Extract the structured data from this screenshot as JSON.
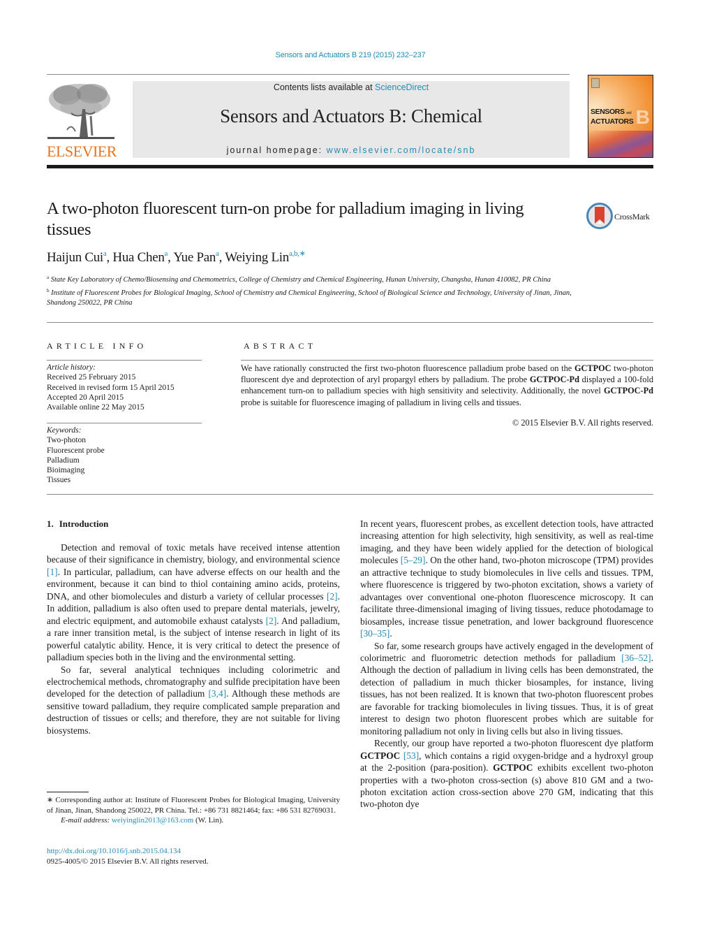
{
  "header": {
    "citation": "Sensors and Actuators B 219 (2015) 232–237",
    "contents_prefix": "Contents lists available at ",
    "contents_link": "ScienceDirect",
    "journal_title": "Sensors and Actuators B: Chemical",
    "homepage_prefix": "journal homepage: ",
    "homepage_link": "www.elsevier.com/locate/snb",
    "publisher_logo": "ELSEVIER",
    "cover": {
      "line1": "SENSORS",
      "and": "and",
      "line2": "ACTUATORS",
      "letter": "B"
    }
  },
  "article": {
    "title": "A two-photon fluorescent turn-on probe for palladium imaging in living tissues",
    "crossmark_label": "CrossMark",
    "authors": [
      {
        "name": "Haijun Cui",
        "aff": "a"
      },
      {
        "name": "Hua Chen",
        "aff": "a"
      },
      {
        "name": "Yue Pan",
        "aff": "a"
      },
      {
        "name": "Weiying Lin",
        "aff": "a,b,∗"
      }
    ],
    "affiliations": [
      {
        "mark": "a",
        "text": "State Key Laboratory of Chemo/Biosensing and Chemometrics, College of Chemistry and Chemical Engineering, Hunan University, Changsha, Hunan 410082, PR China"
      },
      {
        "mark": "b",
        "text": "Institute of Fluorescent Probes for Biological Imaging, School of Chemistry and Chemical Engineering, School of Biological Science and Technology, University of Jinan, Jinan, Shandong 250022, PR China"
      }
    ]
  },
  "article_info": {
    "heading": "ARTICLE INFO",
    "history_label": "Article history:",
    "history": [
      "Received 25 February 2015",
      "Received in revised form 15 April 2015",
      "Accepted 20 April 2015",
      "Available online 22 May 2015"
    ],
    "keywords_label": "Keywords:",
    "keywords": [
      "Two-photon",
      "Fluorescent probe",
      "Palladium",
      "Bioimaging",
      "Tissues"
    ]
  },
  "abstract": {
    "heading": "ABSTRACT",
    "parts": [
      {
        "t": "We have rationally constructed the first two-photon fluorescence palladium probe based on the ",
        "b": false
      },
      {
        "t": "GCTPOC",
        "b": true
      },
      {
        "t": " two-photon fluorescent dye and deprotection of aryl propargyl ethers by palladium. The probe ",
        "b": false
      },
      {
        "t": "GCTPOC-Pd",
        "b": true
      },
      {
        "t": " displayed a 100-fold enhancement turn-on to palladium species with high sensitivity and selectivity. Additionally, the novel ",
        "b": false
      },
      {
        "t": "GCTPOC-Pd",
        "b": true
      },
      {
        "t": " probe is suitable for fluorescence imaging of palladium in living cells and tissues.",
        "b": false
      }
    ],
    "copyright": "© 2015 Elsevier B.V. All rights reserved."
  },
  "introduction": {
    "number": "1.",
    "heading": "Introduction",
    "left_paragraphs": [
      [
        {
          "t": "Detection and removal of toxic metals have received intense attention because of their significance in chemistry, biology, and environmental science "
        },
        {
          "t": "[1]",
          "ref": true
        },
        {
          "t": ". In particular, palladium, can have adverse effects on our health and the environment, because it can bind to thiol containing amino acids, proteins, DNA, and other biomolecules and disturb a variety of cellular processes "
        },
        {
          "t": "[2]",
          "ref": true
        },
        {
          "t": ". In addition, palladium is also often used to prepare dental materials, jewelry, and electric equipment, and automobile exhaust catalysts "
        },
        {
          "t": "[2]",
          "ref": true
        },
        {
          "t": ". And palladium, a rare inner transition metal, is the subject of intense research in light of its powerful catalytic ability. Hence, it is very critical to detect the presence of palladium species both in the living and the environmental setting."
        }
      ],
      [
        {
          "t": "So far, several analytical techniques including colorimetric and electrochemical methods, chromatography and sulfide precipitation have been developed for the detection of palladium "
        },
        {
          "t": "[3,4]",
          "ref": true
        },
        {
          "t": ". Although these methods are sensitive toward palladium, they require complicated sample preparation and destruction of tissues or cells; and therefore, they are not suitable for living biosystems."
        }
      ]
    ],
    "right_paragraphs": [
      [
        {
          "t": "In recent years, fluorescent probes, as excellent detection tools, have attracted increasing attention for high selectivity, high sensitivity, as well as real-time imaging, and they have been widely applied for the detection of biological molecules "
        },
        {
          "t": "[5–29]",
          "ref": true
        },
        {
          "t": ". On the other hand, two-photon microscope (TPM) provides an attractive technique to study biomolecules in live cells and tissues. TPM, where fluorescence is triggered by two-photon excitation, shows a variety of advantages over conventional one-photon fluorescence microscopy. It can facilitate three-dimensional imaging of living tissues, reduce photodamage to biosamples, increase tissue penetration, and lower background fluorescence "
        },
        {
          "t": "[30–35]",
          "ref": true
        },
        {
          "t": "."
        }
      ],
      [
        {
          "t": "So far, some research groups have actively engaged in the development of colorimetric and fluorometric detection methods for palladium "
        },
        {
          "t": "[36–52]",
          "ref": true
        },
        {
          "t": ". Although the dection of palladium in living cells has been demonstrated, the detection of palladium in much thicker biosamples, for instance, living tissues, has not been realized. It is known that two-photon fluorescent probes are favorable for tracking biomolecules in living tissues. Thus, it is of great interest to design two photon fluorescent probes which are suitable for monitoring palladium not only in living cells but also in living tissues."
        }
      ],
      [
        {
          "t": "Recently, our group have reported a two-photon fluorescent dye platform "
        },
        {
          "t": "GCTPOC",
          "bold": true
        },
        {
          "t": " "
        },
        {
          "t": "[53]",
          "ref": true
        },
        {
          "t": ", which contains a rigid oxygen-bridge and a hydroxyl group at the 2-position (para-position). "
        },
        {
          "t": "GCTPOC",
          "bold": true
        },
        {
          "t": " exhibits excellent two-photon properties with a two-photon cross-section (s) above 810 GM and a two-photon excitation action cross-section above 270 GM, indicating that this two-photon dye"
        }
      ]
    ]
  },
  "footnotes": {
    "corresponding": "∗  Corresponding author at: Institute of Fluorescent Probes for Biological Imaging, University of Jinan, Jinan, Shandong 250022, PR China. Tel.: +86 731 8821464; fax: +86 531 82769031.",
    "email_label": "E-mail address:",
    "email": "weiyinglin2013@163.com",
    "email_suffix": " (W. Lin).",
    "doi": "http://dx.doi.org/10.1016/j.snb.2015.04.134",
    "issn_copyright": "0925-4005/© 2015 Elsevier B.V. All rights reserved."
  }
}
